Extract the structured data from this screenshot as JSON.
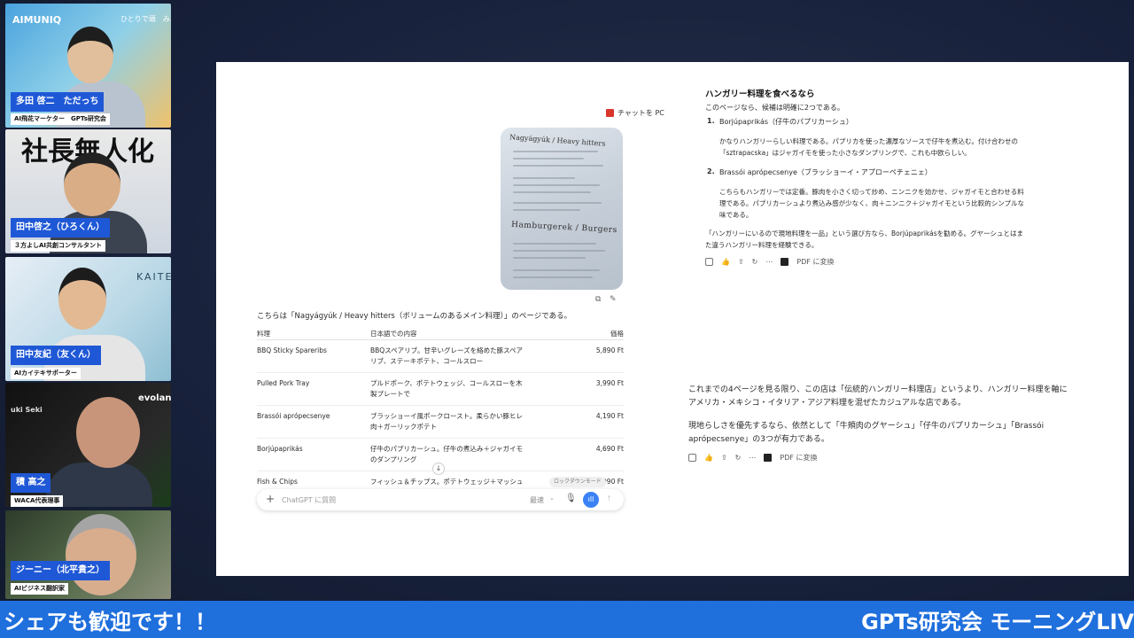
{
  "participants": [
    {
      "name": "多田 啓二　ただっち",
      "role": "AI飛花マーケター　GPTs研究会",
      "brand": "AIMUNIQ",
      "tagline": "ひとりで頑　みんなの"
    },
    {
      "name": "田中啓之（ひろくん）",
      "role": "３方よしAI共創コンサルタント",
      "bg_text": "社長無人化"
    },
    {
      "name": "田中友紀（友くん）",
      "role": "AIカイテキサポーター",
      "bg_text": "KAITE"
    },
    {
      "name": "積 高之",
      "role": "WACA代表理事",
      "brand": "evolan",
      "sub": "uki Seki"
    },
    {
      "name": "ジーニー（北平貴之）",
      "role": "AIビジネス翻訳家"
    }
  ],
  "left_doc": {
    "pdf_label": "チャットを PC",
    "photo_header": "Nagyágyúk / Heavy hitters",
    "photo_big": "Hamburgerek / Burgers",
    "intro": "こちらは「Nagyágyúk / Heavy hitters（ボリュームのあるメイン料理）」のページである。",
    "columns": [
      "料理",
      "日本語での内容",
      "価格"
    ],
    "rows": [
      {
        "dish": "BBQ Sticky Spareribs",
        "desc1": "BBQスペアリブ。甘辛いグレーズを絡めた豚スペア",
        "desc2": "リブ、ステーキポテト、コールスロー",
        "price": "5,890 Ft"
      },
      {
        "dish": "Pulled Pork Tray",
        "desc1": "プルドポーク、ポテトウェッジ、コールスローを木",
        "desc2": "製プレートで",
        "price": "3,990 Ft"
      },
      {
        "dish": "Brassói aprópecsenye",
        "desc1": "ブラッショーイ風ポークロースト。柔らかい豚ヒレ",
        "desc2": "肉＋ガーリックポテト",
        "price": "4,190 Ft"
      },
      {
        "dish": "Borjúpaprikás",
        "desc1": "仔牛のパプリカーシュ。仔牛の煮込み＋ジャガイモ",
        "desc2": "のダンプリング",
        "price": "4,690 Ft"
      },
      {
        "dish": "Fish & Chips",
        "desc1": "フィッシュ＆チップス。ポテトウェッジ＋マッシュ",
        "desc2": "",
        "price": "5,990 Ft"
      }
    ],
    "locked_chip": "ロックダウンモード",
    "chat_placeholder": "ChatGPT に質問",
    "model_label": "最速"
  },
  "right_doc": {
    "heading": "ハンガリー料理を食べるなら",
    "lead": "このページなら、候補は明確に2つである。",
    "items": [
      {
        "num": "1.",
        "title": "Borjúpaprikás（仔牛のパプリカーシュ）",
        "p1": "かなりハンガリーらしい料理である。パプリカを使った濃厚なソースで仔牛を煮込む。付け合わせの",
        "p2": "「sztrapacska」はジャガイモを使った小さなダンプリングで、これも中欧らしい。"
      },
      {
        "num": "2.",
        "title": "Brassói aprópecsenye（ブラッショーイ・アプローペチェニェ）",
        "p1": "こちらもハンガリーでは定番。豚肉を小さく切って炒め、ニンニクを効かせ、ジャガイモと合わせる料",
        "p2": "理である。パプリカーシュより煮込み感が少なく、肉＋ニンニク＋ジャガイモという比較的シンプルな",
        "p3": "味である。"
      }
    ],
    "closing1": "「ハンガリーにいるので現地料理を一品」という選び方なら、Borjúpaprikásを勧める。グヤーシュとはま",
    "closing2": "た違うハンガリー料理を経験できる。",
    "pdf_convert": "PDF に変換",
    "summary1": "これまでの4ページを見る限り、この店は「伝統的ハンガリー料理店」というより、ハンガリー料理を軸に",
    "summary2": "アメリカ・メキシコ・イタリア・アジア料理を混ぜたカジュアルな店である。",
    "summary3": "現地らしさを優先するなら、依然として「牛頬肉のグヤーシュ」「仔牛のパプリカーシュ」「Brassói",
    "summary4": "aprópecsenye」の3つが有力である。",
    "pdf_convert2": "PDF に変換"
  },
  "banner": {
    "left": "シェアも歓迎です！！",
    "right": "GPTs研究会 モーニングLIV"
  },
  "colors": {
    "banner": "#1f6fdd",
    "name_label": "#1f58d6",
    "accent_blue": "#3b82f6"
  }
}
